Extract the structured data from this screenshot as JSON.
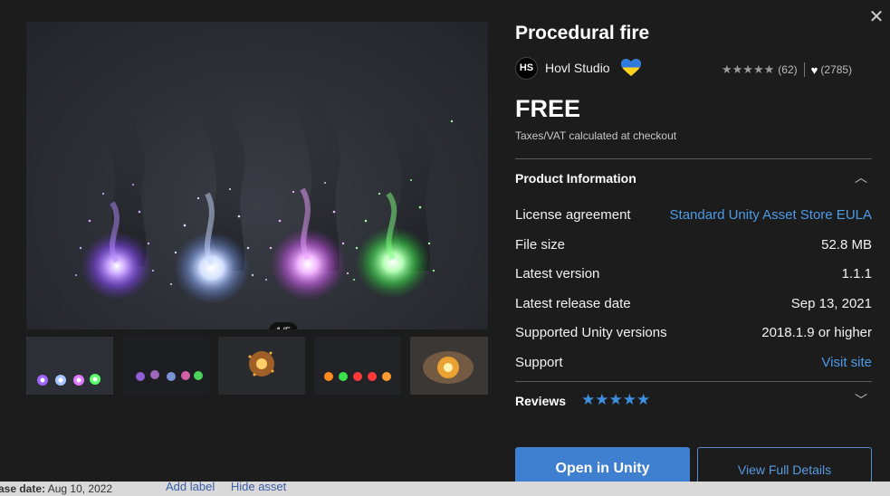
{
  "background_page": {
    "release_date_label": "ase date:",
    "release_date_value": "Aug 10, 2022",
    "add_label": "Add label",
    "hide_asset": "Hide asset"
  },
  "asset": {
    "title": "Procedural fire",
    "publisher": {
      "initials": "HS",
      "name": "Hovl Studio",
      "flag_icon": "ukraine-heart-icon"
    },
    "rating": {
      "stars": "★★★★★",
      "count": "(62)",
      "favorites": "(2785)"
    },
    "price": "FREE",
    "tax_note": "Taxes/VAT calculated at checkout"
  },
  "gallery": {
    "counter": "1/5",
    "thumbnails": [
      "thumbnail-1",
      "thumbnail-2",
      "thumbnail-3",
      "thumbnail-4",
      "thumbnail-5"
    ]
  },
  "product_info": {
    "title": "Product Information",
    "rows": [
      {
        "label": "License agreement",
        "value": "Standard Unity Asset Store EULA",
        "link": true
      },
      {
        "label": "File size",
        "value": "52.8 MB",
        "link": false
      },
      {
        "label": "Latest version",
        "value": "1.1.1",
        "link": false
      },
      {
        "label": "Latest release date",
        "value": "Sep 13, 2021",
        "link": false
      },
      {
        "label": "Supported Unity versions",
        "value": "2018.1.9 or higher",
        "link": false
      },
      {
        "label": "Support",
        "value": "Visit site",
        "link": true
      }
    ]
  },
  "reviews": {
    "title": "Reviews",
    "stars": "★★★★★"
  },
  "actions": {
    "open_in_unity": "Open in Unity",
    "view_full_details": "View Full Details"
  },
  "colors": {
    "accent": "#3f7fcf",
    "link": "#4c9be8",
    "background": "#1c1c1c",
    "fire_colors": [
      "#a064ff",
      "#a6c4ff",
      "#e07bff",
      "#5aff6a"
    ]
  }
}
